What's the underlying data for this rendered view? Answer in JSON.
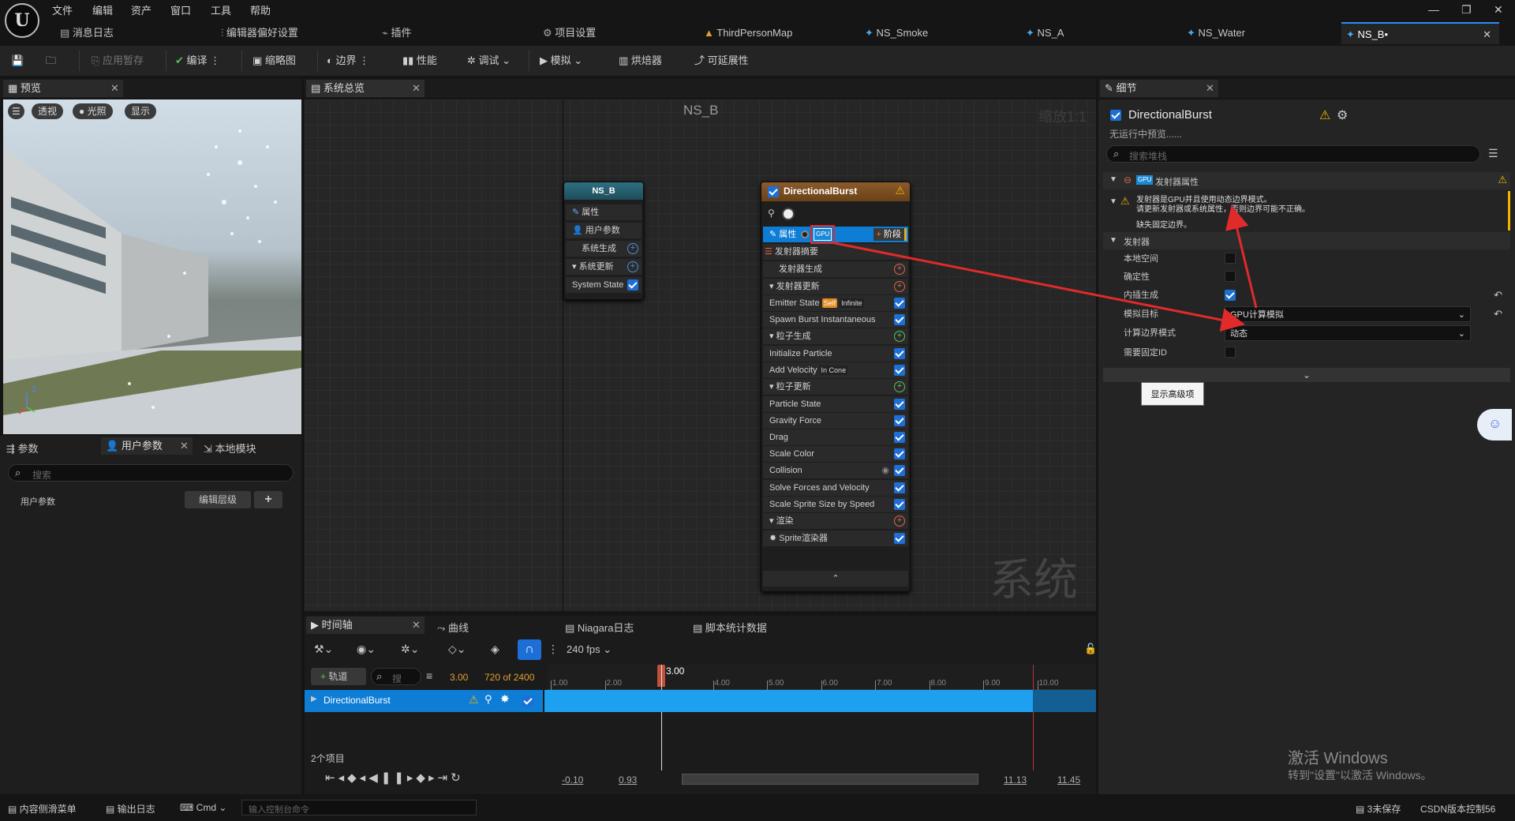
{
  "menu": {
    "items": [
      "文件",
      "编辑",
      "资产",
      "窗口",
      "工具",
      "帮助"
    ]
  },
  "tabs": [
    {
      "label": "消息日志"
    },
    {
      "label": "编辑器偏好设置"
    },
    {
      "label": "插件"
    },
    {
      "label": "项目设置"
    },
    {
      "label": "ThirdPersonMap"
    },
    {
      "label": "NS_Smoke"
    },
    {
      "label": "NS_A"
    },
    {
      "label": "NS_Water"
    },
    {
      "label": "NS_B•"
    }
  ],
  "toolbar": {
    "apply": "应用暂存",
    "compile": "编译",
    "thumbnail": "缩略图",
    "bounds": "边界",
    "performance": "性能",
    "debug": "调试",
    "simulate": "模拟",
    "baker": "烘焙器",
    "scalability": "可延展性"
  },
  "preview": {
    "tab": "预览",
    "view_mode": "透视",
    "lighting": "光照",
    "show": "显示"
  },
  "params": {
    "tab1": "参数",
    "tab2": "用户参数",
    "tab3": "本地模块",
    "search_placeholder": "搜索",
    "label": "用户参数",
    "edit_hierarchy": "编辑层级",
    "add": "+"
  },
  "graph": {
    "tab": "系统总览",
    "title": "NS_B",
    "zoom": "缩放1:1",
    "watermark": "系统",
    "system_node": {
      "title": "NS_B",
      "rows": [
        "属性",
        "用户参数",
        "系统生成",
        "系统更新",
        "System State"
      ]
    },
    "emitter_node": {
      "title": "DirectionalBurst",
      "props_label": "属性",
      "gpu_badge": "GPU",
      "stage_label": "阶段",
      "summary": "发射器摘要",
      "spawn": "发射器生成",
      "update": "发射器更新",
      "emitter_state": "Emitter State",
      "self_tag": "Self",
      "infinite_tag": "Infinite",
      "spawn_burst": "Spawn Burst Instantaneous",
      "particle_spawn": "粒子生成",
      "init_particle": "Initialize Particle",
      "add_velocity": "Add Velocity",
      "in_cone_tag": "In Cone",
      "particle_update": "粒子更新",
      "particle_state": "Particle State",
      "gravity": "Gravity Force",
      "drag": "Drag",
      "scale_color": "Scale Color",
      "collision": "Collision",
      "solve_forces": "Solve Forces and Velocity",
      "scale_sprite": "Scale Sprite Size by Speed",
      "render": "渲染",
      "sprite_renderer": "Sprite渲染器"
    }
  },
  "details": {
    "tab": "细节",
    "emitter_name": "DirectionalBurst",
    "status": "无运行中预览......",
    "search_placeholder": "搜索堆栈",
    "section_props": "发射器属性",
    "gpu_badge": "GPU",
    "warning_line1": "发射器是GPU并且使用动态边界模式。",
    "warning_line2": "请更新发射器或系统属性，否则边界可能不正确。",
    "missing_bounds": "缺失固定边界。",
    "section_emitter": "发射器",
    "rows": {
      "local_space": "本地空间",
      "determinism": "确定性",
      "interp_spawn": "内插生成",
      "sim_target": "模拟目标",
      "calc_bounds": "计算边界模式",
      "requires_id": "需要固定ID"
    },
    "sim_target_value": "GPU计算模拟",
    "calc_bounds_value": "动态",
    "show_advanced": "显示高级项"
  },
  "timeline": {
    "tab1": "时间轴",
    "tab2": "曲线",
    "tab3": "Niagara日志",
    "tab4": "脚本统计数据",
    "fps": "240 fps",
    "add_track": "轨道",
    "search_placeholder": "搜",
    "current_time": "3.00",
    "frame": "720 of 2400",
    "playhead_label": "3.00",
    "ticks": [
      "1.00",
      "2.00",
      "3.00",
      "4.00",
      "5.00",
      "6.00",
      "7.00",
      "8.00",
      "9.00",
      "10.00"
    ],
    "track": "DirectionalBurst",
    "item_count": "2个项目",
    "range_start": "-0.10",
    "range_in": "0.93",
    "range_out": "11.13",
    "range_end": "11.45"
  },
  "statusbar": {
    "content_drawer": "内容侧滑菜单",
    "output_log": "输出日志",
    "cmd": "Cmd",
    "console_placeholder": "输入控制台命令",
    "unsaved": "3未保存",
    "source_control": "CSDN版本控制56"
  },
  "windows_activation": {
    "line1": "激活 Windows",
    "line2": "转到\"设置\"以激活 Windows。"
  },
  "colors": {
    "accent": "#2a8bff",
    "selection": "#0e7dd6",
    "warning": "#f0b400",
    "annotation": "#e12a2a"
  }
}
